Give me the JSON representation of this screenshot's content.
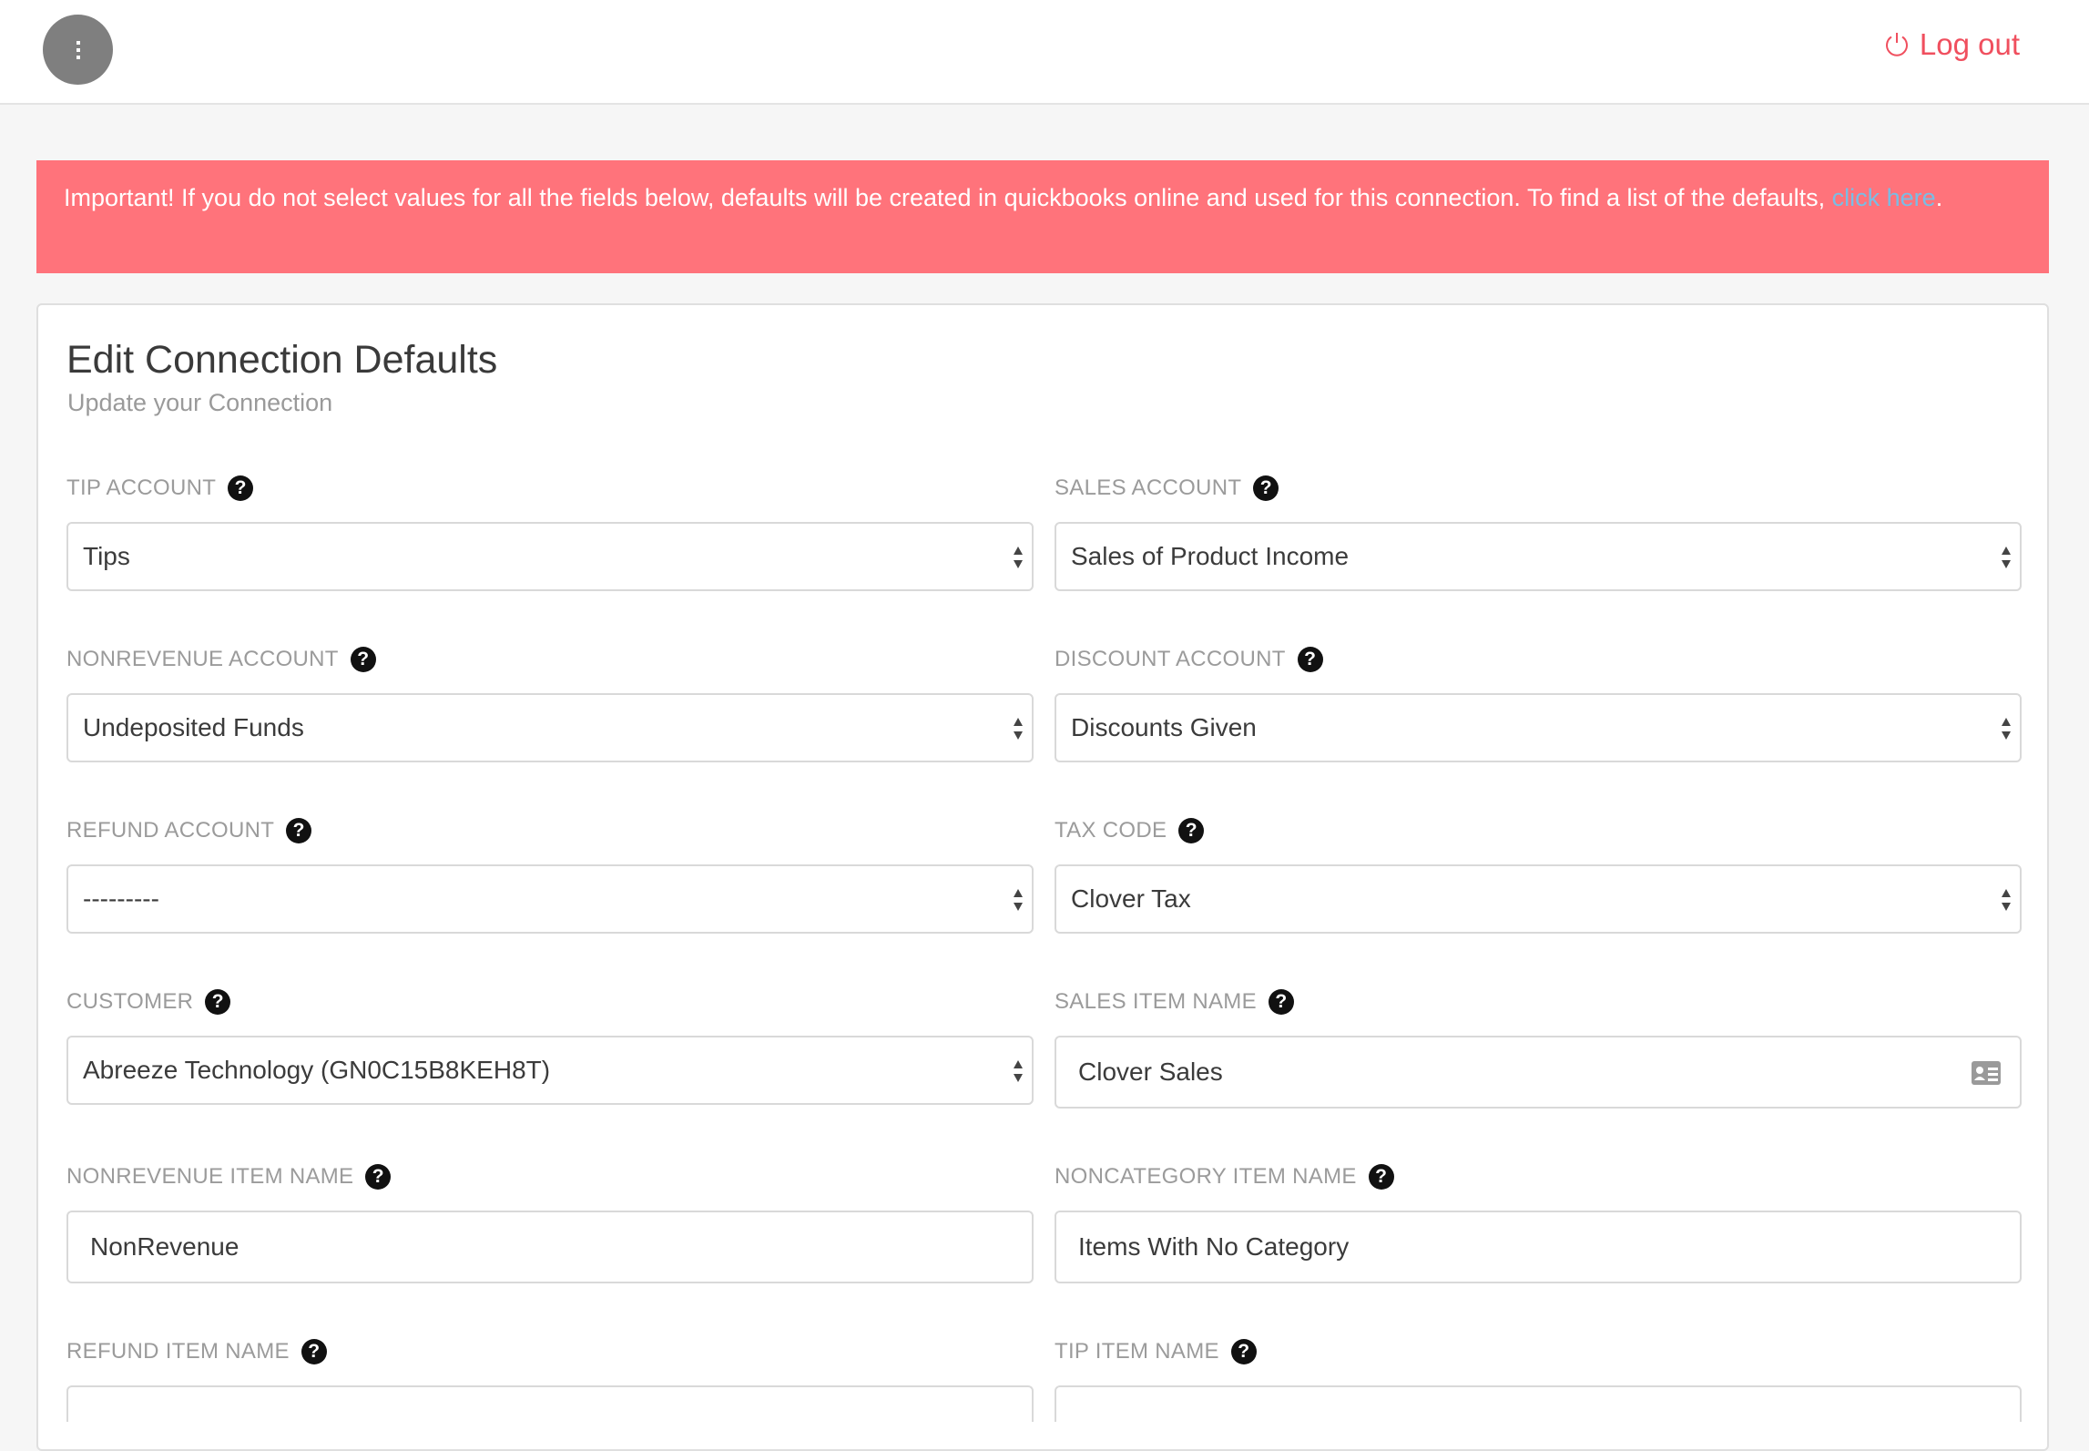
{
  "header": {
    "menu_icon": "vertical-ellipsis-icon",
    "logout_icon": "power-icon",
    "logout_label": "Log out",
    "accent_color": "#f04f5e"
  },
  "alert": {
    "text": "Important! If you do not select values for all the fields below, defaults will be created in quickbooks online and used for this connection. To find a list of the defaults, ",
    "link_text": "click here",
    "suffix": ".",
    "background_color": "#ff737b",
    "link_color": "#79bde5"
  },
  "form": {
    "title": "Edit Connection Defaults",
    "subtitle": "Update your Connection",
    "fields": {
      "tip_account": {
        "label": "TIP ACCOUNT",
        "value": "Tips"
      },
      "sales_account": {
        "label": "SALES ACCOUNT",
        "value": "Sales of Product Income"
      },
      "nonrevenue_account": {
        "label": "NONREVENUE ACCOUNT",
        "value": "Undeposited Funds"
      },
      "discount_account": {
        "label": "DISCOUNT ACCOUNT",
        "value": "Discounts Given"
      },
      "refund_account": {
        "label": "REFUND ACCOUNT",
        "value": "---------"
      },
      "tax_code": {
        "label": "TAX CODE",
        "value": "Clover Tax"
      },
      "customer": {
        "label": "CUSTOMER",
        "value": "Abreeze Technology (GN0C15B8KEH8T)"
      },
      "sales_item_name": {
        "label": "SALES ITEM NAME",
        "value": "Clover Sales"
      },
      "nonrevenue_item_name": {
        "label": "NONREVENUE ITEM NAME",
        "value": "NonRevenue"
      },
      "noncategory_item_name": {
        "label": "NONCATEGORY ITEM NAME",
        "value": "Items With No Category"
      },
      "refund_item_name": {
        "label": "REFUND ITEM NAME",
        "value": ""
      },
      "tip_item_name": {
        "label": "TIP ITEM NAME",
        "value": ""
      }
    },
    "help_glyph": "?"
  }
}
